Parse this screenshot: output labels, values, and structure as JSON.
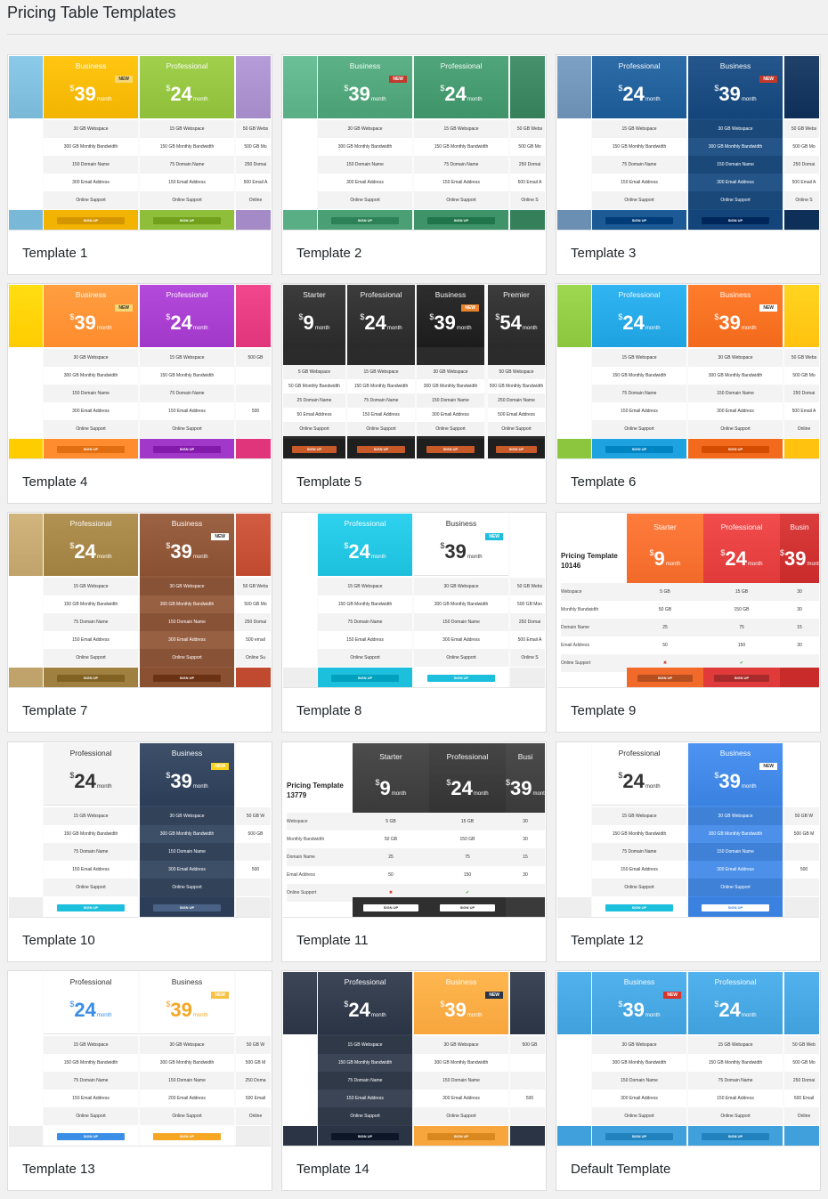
{
  "page": {
    "title": "Pricing Table Templates"
  },
  "templates": [
    {
      "label": "Template 1",
      "style": "colored",
      "cols": [
        {
          "color": "#7ab8d8",
          "partial": "left"
        },
        {
          "color": "#f2b400",
          "name": "Business",
          "price": "39",
          "ribbon": "NEW",
          "ribbonColor": "#f7d774",
          "btn": "SIGN UP",
          "rows": [
            "30 GB Webspace",
            "300 GB Monthly Bandwidth",
            "150 Domain Name",
            "300 Email Address",
            "Online Support"
          ]
        },
        {
          "color": "#8fbf3a",
          "name": "Professional",
          "price": "24",
          "btn": "SIGN UP",
          "rows": [
            "15 GB Webspace",
            "150 GB Monthly Bandwidth",
            "75 Domain Name",
            "150 Email Address",
            "Online Support"
          ]
        },
        {
          "color": "#a48bc8",
          "partial": "right",
          "rows": [
            "50 GB Webs",
            "500 GB Mo",
            "250 Domai",
            "500 Email A",
            "Online"
          ]
        }
      ]
    },
    {
      "label": "Template 2",
      "style": "colored",
      "cols": [
        {
          "color": "#5aae86",
          "partial": "left"
        },
        {
          "color": "#4aa074",
          "name": "Business",
          "price": "39",
          "ribbon": "NEW",
          "ribbonColor": "#c0392b",
          "btn": "SIGN UP",
          "rows": [
            "30 GB Webspace",
            "300 GB Monthly Bandwidth",
            "150 Domain Name",
            "300 Email Address",
            "Online Support"
          ]
        },
        {
          "color": "#3e9468",
          "name": "Professional",
          "price": "24",
          "btn": "SIGN UP",
          "rows": [
            "15 GB Webspace",
            "150 GB Monthly Bandwidth",
            "75 Domain Name",
            "150 Email Address",
            "Online Support"
          ]
        },
        {
          "color": "#35805a",
          "partial": "right",
          "rows": [
            "50 GB Webs",
            "500 GB Mo",
            "250 Domai",
            "500 Email A",
            "Online S"
          ]
        }
      ]
    },
    {
      "label": "Template 3",
      "style": "colored",
      "cols": [
        {
          "color": "#6b8fb3",
          "partial": "left"
        },
        {
          "color": "#1c5a96",
          "name": "Professional",
          "price": "24",
          "btn": "SIGN UP",
          "rows": [
            "15 GB Webspace",
            "150 GB Monthly Bandwidth",
            "75 Domain Name",
            "150 Email Address",
            "Online Support"
          ]
        },
        {
          "color": "#13457a",
          "name": "Business",
          "price": "39",
          "ribbon": "NEW",
          "ribbonColor": "#c0392b",
          "btn": "SIGN UP",
          "dark": true,
          "rows": [
            "30 GB Webspace",
            "300 GB Monthly Bandwidth",
            "150 Domain Name",
            "300 Email Address",
            "Online Support"
          ]
        },
        {
          "color": "#0e2f57",
          "partial": "right",
          "rows": [
            "50 GB Webs",
            "500 GB Mo",
            "250 Domai",
            "500 Email A",
            "Online S"
          ]
        }
      ]
    },
    {
      "label": "Template 4",
      "style": "colored",
      "cols": [
        {
          "color": "#ffcc00",
          "partial": "left"
        },
        {
          "color": "#ff8c2e",
          "name": "Business",
          "price": "39",
          "ribbon": "NEW",
          "ribbonColor": "#f7d774",
          "btn": "SIGN UP",
          "rows": [
            "30 GB Webspace",
            "300 GB Monthly Bandwidth",
            "150 Domain Name",
            "300 Email Address",
            "Online Support"
          ]
        },
        {
          "color": "#a238c9",
          "name": "Professional",
          "price": "24",
          "btn": "SIGN UP",
          "rows": [
            "15 GB Webspace",
            "150 GB Monthly Bandwidth",
            "75 Domain Name",
            "150 Email Address",
            "Online Support"
          ]
        },
        {
          "color": "#e0357a",
          "partial": "right",
          "rows": [
            "500 GB",
            "",
            "",
            "500",
            ""
          ]
        }
      ]
    },
    {
      "label": "Template 5",
      "style": "dark",
      "cols": [
        {
          "color": "#2a2a2a",
          "name": "Starter",
          "price": "9",
          "btn": "SIGN UP",
          "rows": [
            "5 GB Webspace",
            "50 GB Monthly Bandwidth",
            "25 Domain Name",
            "50 Email Address",
            "Online Support"
          ]
        },
        {
          "color": "#2a2a2a",
          "name": "Professional",
          "price": "24",
          "btn": "SIGN UP",
          "rows": [
            "15 GB Webspace",
            "150 GB Monthly Bandwidth",
            "75 Domain Name",
            "150 Email Address",
            "Online Support"
          ]
        },
        {
          "color": "#1c1c1c",
          "name": "Business",
          "price": "39",
          "ribbon": "NEW",
          "ribbonColor": "#e8832a",
          "btn": "SIGN UP",
          "rows": [
            "30 GB Webspace",
            "300 GB Monthly Bandwidth",
            "150 Domain Name",
            "300 Email Address",
            "Online Support"
          ]
        },
        {
          "color": "#2a2a2a",
          "name": "Premier",
          "price": "54",
          "btn": "SIGN UP",
          "rows": [
            "50 GB Webspace",
            "500 GB Monthly Bandwidth",
            "250 Domain Name",
            "500 Email Address",
            "Online Support"
          ]
        }
      ]
    },
    {
      "label": "Template 6",
      "style": "colored",
      "cols": [
        {
          "color": "#8cc63e",
          "partial": "left"
        },
        {
          "color": "#1ea2e0",
          "name": "Professional",
          "price": "24",
          "btn": "SIGN UP",
          "rows": [
            "15 GB Webspace",
            "150 GB Monthly Bandwidth",
            "75 Domain Name",
            "150 Email Address",
            "Online Support"
          ]
        },
        {
          "color": "#f26a1b",
          "name": "Business",
          "price": "39",
          "ribbon": "NEW",
          "ribbonColor": "#ffffff",
          "btn": "SIGN UP",
          "rows": [
            "30 GB Webspace",
            "300 GB Monthly Bandwidth",
            "150 Domain Name",
            "300 Email Address",
            "Online Support"
          ]
        },
        {
          "color": "#ffc20e",
          "partial": "right",
          "rows": [
            "50 GB Webs",
            "500 GB Mo",
            "250 Domai",
            "500 Email A",
            "Online"
          ]
        }
      ]
    },
    {
      "label": "Template 7",
      "style": "colored",
      "cols": [
        {
          "color": "#bfa36a",
          "partial": "left"
        },
        {
          "color": "#a08040",
          "name": "Professional",
          "price": "24",
          "btn": "SIGN UP",
          "rows": [
            "15 GB Webspace",
            "150 GB Monthly Bandwidth",
            "75 Domain Name",
            "150 Email Address",
            "Online Support"
          ]
        },
        {
          "color": "#8a5032",
          "name": "Business",
          "price": "39",
          "ribbon": "NEW",
          "ribbonColor": "#ffffff",
          "btn": "SIGN UP",
          "dark": true,
          "rows": [
            "30 GB Webspace",
            "300 GB Monthly Bandwidth",
            "150 Domain Name",
            "300 Email Address",
            "Online Support"
          ]
        },
        {
          "color": "#c04a30",
          "partial": "right",
          "rows": [
            "50 GB Webs",
            "500 GB Mo",
            "250 Domai",
            "500 email",
            "Online Su"
          ]
        }
      ]
    },
    {
      "label": "Template 8",
      "style": "light",
      "cols": [
        {
          "color": "#ffffff",
          "partial": "left"
        },
        {
          "color": "#1cbfdc",
          "name": "Professional",
          "price": "24",
          "btn": "SIGN UP",
          "rows": [
            "15 GB Webspace",
            "150 GB Monthly Bandwidth",
            "75 Domain Name",
            "150 Email Address",
            "Online Support"
          ]
        },
        {
          "color": "#ffffff",
          "name": "Business",
          "price": "39",
          "ribbon": "NEW",
          "ribbonColor": "#1cbfdc",
          "btn": "SIGN UP",
          "light": true,
          "rows": [
            "30 GB Webspace",
            "300 GB Monthly Bandwidth",
            "150 Domain Name",
            "300 Email Address",
            "Online Support"
          ]
        },
        {
          "color": "#ffffff",
          "partial": "right",
          "rows": [
            "50 GB Webs",
            "500 GB Mon",
            "250 Domai",
            "500 Email A",
            "Online S"
          ]
        }
      ]
    },
    {
      "label": "Template 9",
      "style": "table",
      "header": "Pricing Template 10146",
      "cols": [
        {
          "color": "#f26a2a",
          "name": "Starter",
          "price": "9",
          "btn": "SIGN UP",
          "rows": [
            "5 GB",
            "50 GB",
            "25",
            "50",
            "✖"
          ]
        },
        {
          "color": "#e03a3a",
          "name": "Professional",
          "price": "24",
          "btn": "SIGN UP",
          "rows": [
            "15 GB",
            "150 GB",
            "75",
            "150",
            "✔"
          ]
        },
        {
          "color": "#c92a2a",
          "name": "Busin",
          "price": "39",
          "partial": "right",
          "rows": [
            "30",
            "30",
            "15",
            "30",
            ""
          ]
        }
      ],
      "rowLabels": [
        "Webspace",
        "Monthly Bandwidth",
        "Domain Name",
        "Email Address",
        "Online Support"
      ]
    },
    {
      "label": "Template 10",
      "style": "light",
      "cols": [
        {
          "color": "#ffffff",
          "partial": "left"
        },
        {
          "color": "#f4f4f4",
          "name": "Professional",
          "price": "24",
          "btn": "SIGN UP",
          "light": true,
          "rows": [
            "15 GB Webspace",
            "150 GB Monthly Bandwidth",
            "75 Domain Name",
            "150 Email Address",
            "Online Support"
          ]
        },
        {
          "color": "#2c3e57",
          "name": "Business",
          "price": "39",
          "ribbon": "NEW",
          "ribbonColor": "#f7d21e",
          "btn": "SIGN UP",
          "dark": true,
          "rows": [
            "30 GB Webspace",
            "300 GB Monthly Bandwidth",
            "150 Domain Name",
            "300 Email Address",
            "Online Support"
          ]
        },
        {
          "color": "#ffffff",
          "partial": "right",
          "rows": [
            "50 GB W",
            "500 GB",
            "",
            "500",
            ""
          ]
        }
      ]
    },
    {
      "label": "Template 11",
      "style": "table",
      "header": "Pricing Template 13779",
      "dark": true,
      "cols": [
        {
          "color": "#3a3a3a",
          "name": "Starter",
          "price": "9",
          "btn": "SIGN UP",
          "rows": [
            "5 GB",
            "50 GB",
            "25",
            "50",
            "✖"
          ]
        },
        {
          "color": "#333333",
          "name": "Professional",
          "price": "24",
          "btn": "SIGN UP",
          "rows": [
            "15 GB",
            "150 GB",
            "75",
            "150",
            "✔"
          ]
        },
        {
          "color": "#3a3a3a",
          "name": "Busi",
          "price": "39",
          "partial": "right",
          "rows": [
            "30",
            "30",
            "15",
            "30",
            ""
          ]
        }
      ],
      "rowLabels": [
        "Webspace",
        "Monthly Bandwidth",
        "Domain Name",
        "Email Address",
        "Online Support"
      ]
    },
    {
      "label": "Template 12",
      "style": "light",
      "cols": [
        {
          "color": "#ffffff",
          "partial": "left"
        },
        {
          "color": "#ffffff",
          "name": "Professional",
          "price": "24",
          "btn": "SIGN UP",
          "light": true,
          "rows": [
            "15 GB Webspace",
            "150 GB Monthly Bandwidth",
            "75 Domain Name",
            "150 Email Address",
            "Online Support"
          ]
        },
        {
          "color": "#3b82e0",
          "name": "Business",
          "price": "39",
          "ribbon": "NEW",
          "ribbonColor": "#ffffff",
          "btn": "SIGN UP",
          "dark": true,
          "rows": [
            "30 GB Webspace",
            "300 GB Monthly Bandwidth",
            "150 Domain Name",
            "300 Email Address",
            "Online Support"
          ]
        },
        {
          "color": "#ffffff",
          "partial": "right",
          "rows": [
            "50 GB W",
            "500 GB M",
            "",
            "500",
            ""
          ]
        }
      ]
    },
    {
      "label": "Template 13",
      "style": "light",
      "cols": [
        {
          "color": "#ffffff",
          "partial": "left"
        },
        {
          "color": "#ffffff",
          "name": "Professional",
          "price": "24",
          "btn": "SIGN UP",
          "light": true,
          "priceColor": "#3a8ee6",
          "rows": [
            "15 GB Webspace",
            "150 GB Monthly Bandwidth",
            "75 Domain Name",
            "150 Email Address",
            "Online Support"
          ]
        },
        {
          "color": "#ffffff",
          "name": "Business",
          "price": "39",
          "ribbon": "NEW",
          "ribbonColor": "#f7c244",
          "btn": "SIGN UP",
          "light": true,
          "priceColor": "#f5a623",
          "rows": [
            "30 GB Webspace",
            "300 GB Monthly Bandwidth",
            "150 Domain Name",
            "200 Email Address",
            "Online Support"
          ]
        },
        {
          "color": "#ffffff",
          "partial": "right",
          "rows": [
            "50 GB W",
            "500 GB M",
            "250 Doma",
            "500 Email",
            "Online"
          ]
        }
      ]
    },
    {
      "label": "Template 14",
      "style": "colored",
      "cols": [
        {
          "color": "#2b3445",
          "partial": "left"
        },
        {
          "color": "#2b3445",
          "name": "Professional",
          "price": "24",
          "btn": "SIGN UP",
          "dark": true,
          "rows": [
            "15 GB Webspace",
            "150 GB Monthly Bandwidth",
            "75 Domain Name",
            "150 Email Address",
            "Online Support"
          ]
        },
        {
          "color": "#f7a53d",
          "name": "Business",
          "price": "39",
          "ribbon": "NEW",
          "ribbonColor": "#2b3445",
          "btn": "SIGN UP",
          "rows": [
            "30 GB Webspace",
            "300 GB Monthly Bandwidth",
            "150 Domain Name",
            "300 Email Address",
            "Online Support"
          ]
        },
        {
          "color": "#2b3445",
          "partial": "right",
          "rows": [
            "500 GB",
            "",
            "",
            "500",
            ""
          ]
        }
      ]
    },
    {
      "label": "Default Template",
      "style": "colored",
      "cols": [
        {
          "color": "#3fa0dc",
          "partial": "left"
        },
        {
          "color": "#3fa0dc",
          "name": "Business",
          "price": "39",
          "ribbon": "NEW",
          "ribbonColor": "#d9342b",
          "btn": "SIGN UP",
          "rows": [
            "30 GB Webspace",
            "300 GB Monthly Bandwidth",
            "150 Domain Name",
            "300 Email Address",
            "Online Support"
          ]
        },
        {
          "color": "#3fa0dc",
          "name": "Professional",
          "price": "24",
          "btn": "SIGN UP",
          "rows": [
            "15 GB Webspace",
            "150 GB Monthly Bandwidth",
            "75 Domain Name",
            "150 Email Address",
            "Online Support"
          ]
        },
        {
          "color": "#3fa0dc",
          "partial": "right",
          "rows": [
            "50 GB Web",
            "500 GB Mo",
            "250 Domai",
            "500 Email",
            "Online"
          ]
        }
      ]
    }
  ],
  "common": {
    "month": "month",
    "currency": "$"
  }
}
